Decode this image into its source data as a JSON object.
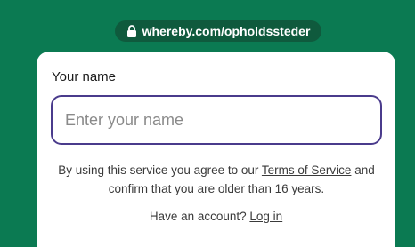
{
  "header": {
    "url": "whereby.com/opholdssteder",
    "lock_icon": "lock-icon"
  },
  "form": {
    "name_label": "Your name",
    "name_placeholder": "Enter your name",
    "name_value": ""
  },
  "terms": {
    "prefix": "By using this service you agree to our ",
    "link": "Terms of Service",
    "suffix": " and confirm that you are older than 16 years."
  },
  "account": {
    "prompt": "Have an account? ",
    "login_link": "Log in"
  },
  "colors": {
    "background": "#0b7a52",
    "url_pill": "#0f5a3d",
    "input_border": "#4a3b8c"
  }
}
